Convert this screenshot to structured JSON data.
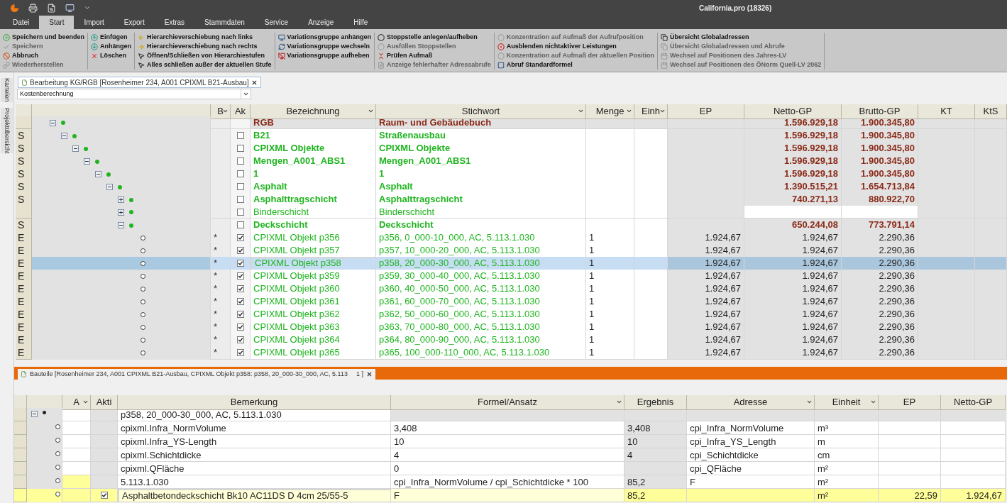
{
  "title_bar": {
    "title": "California.pro (18326)"
  },
  "menu_tabs": [
    {
      "label": "Datei",
      "selected": false
    },
    {
      "label": "Start",
      "selected": true
    },
    {
      "label": "Import",
      "selected": false
    },
    {
      "label": "Export",
      "selected": false
    },
    {
      "label": "Extras",
      "selected": false
    },
    {
      "label": "Stammdaten",
      "selected": false
    },
    {
      "label": "Service",
      "selected": false
    },
    {
      "label": "Anzeige",
      "selected": false
    },
    {
      "label": "Hilfe",
      "selected": false
    }
  ],
  "ribbon": [
    {
      "items": [
        {
          "label": "Speichern und beenden",
          "disabled": false
        },
        {
          "label": "Speichern",
          "disabled": true
        },
        {
          "label": "Abbruch",
          "disabled": false
        },
        {
          "label": "Wiederherstellen",
          "disabled": true
        }
      ]
    },
    {
      "items": [
        {
          "label": "Einfügen",
          "disabled": false
        },
        {
          "label": "Anhängen",
          "disabled": false
        },
        {
          "label": "Löschen",
          "disabled": false
        }
      ]
    },
    {
      "items": [
        {
          "label": "Hierarchieverschiebung nach links",
          "disabled": false
        },
        {
          "label": "Hierarchieverschiebung nach rechts",
          "disabled": false
        },
        {
          "label": "Öffnen/Schließen von Hierarchiestufen",
          "disabled": false
        },
        {
          "label": "Alles schließen außer der aktuellen Stufe",
          "disabled": false
        }
      ]
    },
    {
      "items": [
        {
          "label": "Variationsgruppe anhängen",
          "disabled": false
        },
        {
          "label": "Variationsgruppe wechseln",
          "disabled": false
        },
        {
          "label": "Variationsgruppe aufheben",
          "disabled": false
        }
      ]
    },
    {
      "items": [
        {
          "label": "Stoppstelle anlegen/aufheben",
          "disabled": false
        },
        {
          "label": "Ausfüllen Stoppstellen",
          "disabled": true
        },
        {
          "label": "Prüfen Aufmaß",
          "disabled": false
        },
        {
          "label": "Anzeige fehlerhafter Adressabrufe",
          "disabled": true
        }
      ]
    },
    {
      "items": [
        {
          "label": "Konzentration auf Aufmaß der Aufrufposition",
          "disabled": true
        },
        {
          "label": "Ausblenden nichtaktiver Leistungen",
          "disabled": false
        },
        {
          "label": "Konzentration auf Aufmaß der aktuellen Position",
          "disabled": true
        },
        {
          "label": "Abruf Standardformel",
          "disabled": false
        }
      ]
    },
    {
      "items": [
        {
          "label": "Übersicht Globaladressen",
          "disabled": false
        },
        {
          "label": "Übersicht Globaladressen und Abrufe",
          "disabled": true
        },
        {
          "label": "Wechsel auf Positionen des Jahres-LV",
          "disabled": true
        },
        {
          "label": "Wechsel auf Positionen des ÖNorm Quell-LV 2062",
          "disabled": true
        }
      ]
    }
  ],
  "side_tabs": [
    "Karteien",
    "Projektübersicht"
  ],
  "document_tab": {
    "title": "Bearbeitung KG/RGB [Rosenheimer 234, A001 CPIXML B21-Ausbau]"
  },
  "view_select": {
    "value": "Kostenberechnung"
  },
  "main_table": {
    "columns": [
      {
        "label": "B",
        "filter": true
      },
      {
        "label": "Ak",
        "filter": false
      },
      {
        "label": "Bezeichnung",
        "filter": true
      },
      {
        "label": "Stichwort",
        "filter": true
      },
      {
        "label": "Menge",
        "filter": true
      },
      {
        "label": "Einh",
        "filter": true
      },
      {
        "label": "EP",
        "filter": false
      },
      {
        "label": "Netto-GP",
        "filter": false
      },
      {
        "label": "Brutto-GP",
        "filter": false
      },
      {
        "label": "KT",
        "filter": false
      },
      {
        "label": "KtS",
        "filter": false
      }
    ],
    "rows": [
      {
        "kind": "root",
        "bold": true,
        "expanded": true,
        "selected": false,
        "name": "RGB",
        "keyword": "Raum- und Gebäudebuch",
        "netto": "1.596.929,18",
        "brutto": "1.900.345,80",
        "children": [
          {
            "marker": "S",
            "kind": "group",
            "bold": true,
            "expanded": true,
            "selected": false,
            "active": false,
            "name": "B21",
            "keyword": "Straßenausbau",
            "netto": "1.596.929,18",
            "brutto": "1.900.345,80",
            "children": [
              {
                "marker": "S",
                "kind": "group",
                "bold": true,
                "expanded": true,
                "selected": false,
                "active": false,
                "name": "CPIXML Objekte",
                "keyword": "CPIXML Objekte",
                "netto": "1.596.929,18",
                "brutto": "1.900.345,80",
                "children": [
                  {
                    "marker": "S",
                    "kind": "group",
                    "bold": true,
                    "expanded": true,
                    "selected": false,
                    "active": false,
                    "name": "Mengen_A001_ABS1",
                    "keyword": "Mengen_A001_ABS1",
                    "netto": "1.596.929,18",
                    "brutto": "1.900.345,80",
                    "children": [
                      {
                        "marker": "S",
                        "kind": "group",
                        "bold": true,
                        "expanded": true,
                        "selected": false,
                        "active": false,
                        "name": "1",
                        "keyword": "1",
                        "netto": "1.596.929,18",
                        "brutto": "1.900.345,80",
                        "children": [
                          {
                            "marker": "S",
                            "kind": "group",
                            "bold": true,
                            "expanded": true,
                            "selected": false,
                            "active": false,
                            "name": "Asphalt",
                            "keyword": "Asphalt",
                            "netto": "1.390.515,21",
                            "brutto": "1.654.713,84",
                            "children": [
                              {
                                "marker": "S",
                                "kind": "group",
                                "bold": true,
                                "expanded": false,
                                "selected": false,
                                "active": false,
                                "name": "Asphalttragschicht",
                                "keyword": "Asphalttragschicht",
                                "netto": "740.271,13",
                                "brutto": "880.922,70"
                              },
                              {
                                "kind": "group",
                                "bold": false,
                                "expanded": false,
                                "selected": false,
                                "active": false,
                                "name": "Binderschicht",
                                "keyword": "Binderschicht"
                              },
                              {
                                "marker": "S",
                                "kind": "group",
                                "bold": true,
                                "expanded": true,
                                "selected": false,
                                "active": false,
                                "name": "Deckschicht",
                                "keyword": "Deckschicht",
                                "netto": "650.244,08",
                                "brutto": "773.791,14",
                                "children": [
                                  {
                                    "marker": "E",
                                    "kind": "position",
                                    "bold": false,
                                    "selected": false,
                                    "b": "*",
                                    "active": true,
                                    "name": "CPIXML Objekt p356",
                                    "keyword": "p356, 0_000-10_000, AC, 5.113.1.030",
                                    "menge": "1",
                                    "ep": "1.924,67",
                                    "netto": "1.924,67",
                                    "brutto": "2.290,36"
                                  },
                                  {
                                    "marker": "E",
                                    "kind": "position",
                                    "bold": false,
                                    "selected": false,
                                    "b": "*",
                                    "active": true,
                                    "name": "CPIXML Objekt p357",
                                    "keyword": "p357, 10_000-20_000, AC, 5.113.1.030",
                                    "menge": "1",
                                    "ep": "1.924,67",
                                    "netto": "1.924,67",
                                    "brutto": "2.290,36"
                                  },
                                  {
                                    "marker": "E",
                                    "kind": "position",
                                    "bold": false,
                                    "selected": true,
                                    "b": "*",
                                    "active": true,
                                    "name": "CPIXML Objekt p358",
                                    "keyword": "p358, 20_000-30_000, AC, 5.113.1.030",
                                    "menge": "1",
                                    "ep": "1.924,67",
                                    "netto": "1.924,67",
                                    "brutto": "2.290,36"
                                  },
                                  {
                                    "marker": "E",
                                    "kind": "position",
                                    "bold": false,
                                    "selected": false,
                                    "b": "*",
                                    "active": true,
                                    "name": "CPIXML Objekt p359",
                                    "keyword": "p359, 30_000-40_000, AC, 5.113.1.030",
                                    "menge": "1",
                                    "ep": "1.924,67",
                                    "netto": "1.924,67",
                                    "brutto": "2.290,36"
                                  },
                                  {
                                    "marker": "E",
                                    "kind": "position",
                                    "bold": false,
                                    "selected": false,
                                    "b": "*",
                                    "active": true,
                                    "name": "CPIXML Objekt p360",
                                    "keyword": "p360, 40_000-50_000, AC, 5.113.1.030",
                                    "menge": "1",
                                    "ep": "1.924,67",
                                    "netto": "1.924,67",
                                    "brutto": "2.290,36"
                                  },
                                  {
                                    "marker": "E",
                                    "kind": "position",
                                    "bold": false,
                                    "selected": false,
                                    "b": "*",
                                    "active": true,
                                    "name": "CPIXML Objekt p361",
                                    "keyword": "p361, 60_000-70_000, AC, 5.113.1.030",
                                    "menge": "1",
                                    "ep": "1.924,67",
                                    "netto": "1.924,67",
                                    "brutto": "2.290,36"
                                  },
                                  {
                                    "marker": "E",
                                    "kind": "position",
                                    "bold": false,
                                    "selected": false,
                                    "b": "*",
                                    "active": true,
                                    "name": "CPIXML Objekt p362",
                                    "keyword": "p362, 50_000-60_000, AC, 5.113.1.030",
                                    "menge": "1",
                                    "ep": "1.924,67",
                                    "netto": "1.924,67",
                                    "brutto": "2.290,36"
                                  },
                                  {
                                    "marker": "E",
                                    "kind": "position",
                                    "bold": false,
                                    "selected": false,
                                    "b": "*",
                                    "active": true,
                                    "name": "CPIXML Objekt p363",
                                    "keyword": "p363, 70_000-80_000, AC, 5.113.1.030",
                                    "menge": "1",
                                    "ep": "1.924,67",
                                    "netto": "1.924,67",
                                    "brutto": "2.290,36"
                                  },
                                  {
                                    "marker": "E",
                                    "kind": "position",
                                    "bold": false,
                                    "selected": false,
                                    "b": "*",
                                    "active": true,
                                    "name": "CPIXML Objekt p364",
                                    "keyword": "p364, 80_000-90_000, AC, 5.113.1.030",
                                    "menge": "1",
                                    "ep": "1.924,67",
                                    "netto": "1.924,67",
                                    "brutto": "2.290,36"
                                  },
                                  {
                                    "marker": "E",
                                    "kind": "position",
                                    "bold": false,
                                    "selected": false,
                                    "b": "*",
                                    "active": true,
                                    "name": "CPIXML Objekt p365",
                                    "keyword": "p365, 100_000-110_000, AC, 5.113.1.030",
                                    "menge": "1",
                                    "ep": "1.924,67",
                                    "netto": "1.924,67",
                                    "brutto": "2.290,36"
                                  }
                                ]
                              }
                            ]
                          }
                        ]
                      }
                    ]
                  }
                ]
              }
            ]
          }
        ]
      }
    ]
  },
  "bottom_panel": {
    "tab_title": "Bauteile [Rosenheimer 234, A001 CPIXML B21-Ausbau, CPIXML Objekt p358: p358, 20_000-30_000, AC, 5.113",
    "tab_suffix": "1 ]",
    "columns": [
      {
        "label": "A",
        "filter": true
      },
      {
        "label": "Akti",
        "filter": false
      },
      {
        "label": "Bemerkung",
        "filter": false
      },
      {
        "label": "Formel/Ansatz",
        "filter": true
      },
      {
        "label": "Ergebnis",
        "filter": false
      },
      {
        "label": "Adresse",
        "filter": true
      },
      {
        "label": "Einheit",
        "filter": true
      },
      {
        "label": "EP",
        "filter": false
      },
      {
        "label": "Netto-GP",
        "filter": false
      }
    ],
    "rows": [
      {
        "kind": "group",
        "expanded": true,
        "selected": false,
        "flagged": false,
        "remark": "p358, 20_000-30_000, AC, 5.113.1.030",
        "children": [
          {
            "kind": "item",
            "selected": false,
            "flagged": false,
            "remark": "cpixml.Infra_NormVolume",
            "formula": "3,408",
            "result": "3,408",
            "address": "cpi_Infra_NormVolume",
            "unit": "m³"
          },
          {
            "kind": "item",
            "selected": false,
            "flagged": false,
            "remark": "cpixml.Infra_YS-Length",
            "formula": "10",
            "result": "10",
            "address": "cpi_Infra_YS_Length",
            "unit": "m"
          },
          {
            "kind": "item",
            "selected": false,
            "flagged": false,
            "remark": "cpixml.Schichtdicke",
            "formula": "4",
            "result": "4",
            "address": "cpi_Schichtdicke",
            "unit": "cm"
          },
          {
            "kind": "item",
            "selected": false,
            "flagged": false,
            "remark": "cpixml.QFläche",
            "formula": "0",
            "address": "cpi_QFläche",
            "unit": "m²"
          },
          {
            "kind": "item",
            "selected": false,
            "flagged": true,
            "remark": "5.113.1.030",
            "formula": "cpi_Infra_NormVolume / cpi_Schichtdicke * 100",
            "result": "85,2",
            "address": "F",
            "unit": "m²"
          },
          {
            "kind": "item",
            "selected": true,
            "flagged": true,
            "active": true,
            "remark": "Asphaltbetondeckschicht Bk10 AC11DS D 4cm 25/55-5",
            "formula": "F",
            "result": "85,2",
            "unit": "m²",
            "ep": "22,59",
            "netto": "1.924,67"
          }
        ]
      }
    ]
  }
}
